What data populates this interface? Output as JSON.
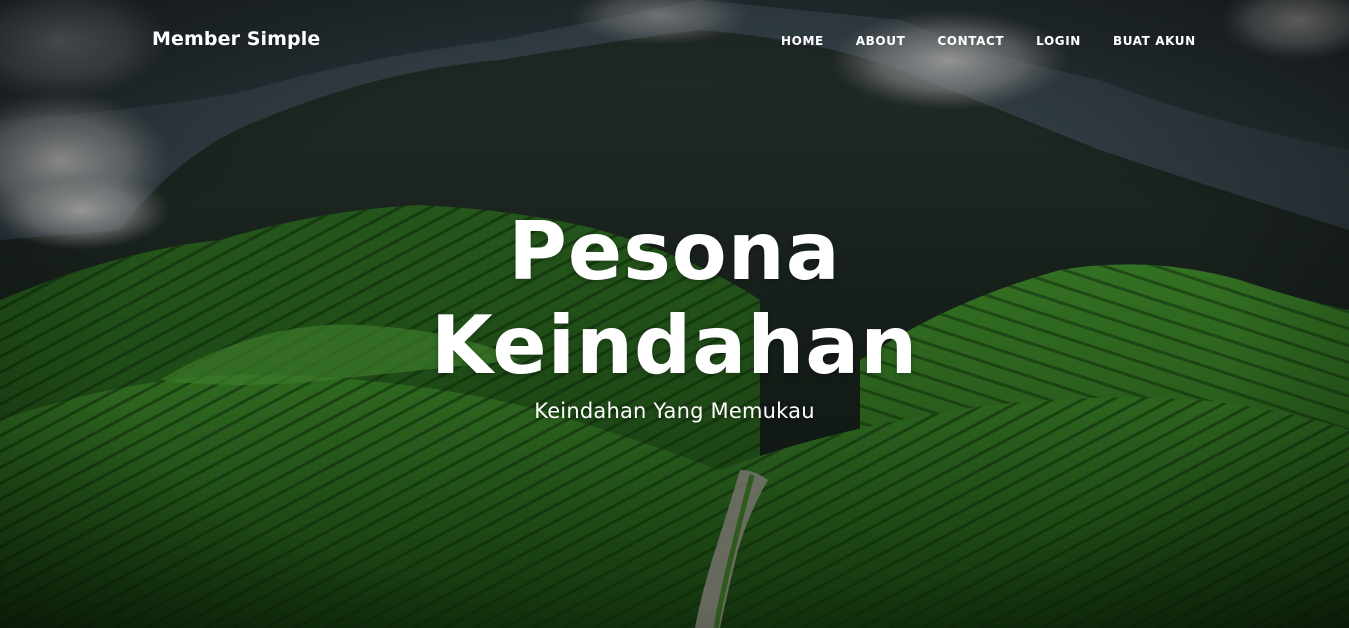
{
  "navbar": {
    "brand": "Member Simple",
    "items": [
      {
        "label": "HOME"
      },
      {
        "label": "ABOUT"
      },
      {
        "label": "CONTACT"
      },
      {
        "label": "LOGIN"
      },
      {
        "label": "BUAT AKUN"
      }
    ]
  },
  "hero": {
    "title_line1": "Pesona",
    "title_line2": "Keindahan",
    "subtitle": "Keindahan Yang Memukau"
  },
  "colors": {
    "text": "#ffffff",
    "grass": "#3a7a26",
    "mountain": "#18221c",
    "sky": "#3b4a52"
  }
}
